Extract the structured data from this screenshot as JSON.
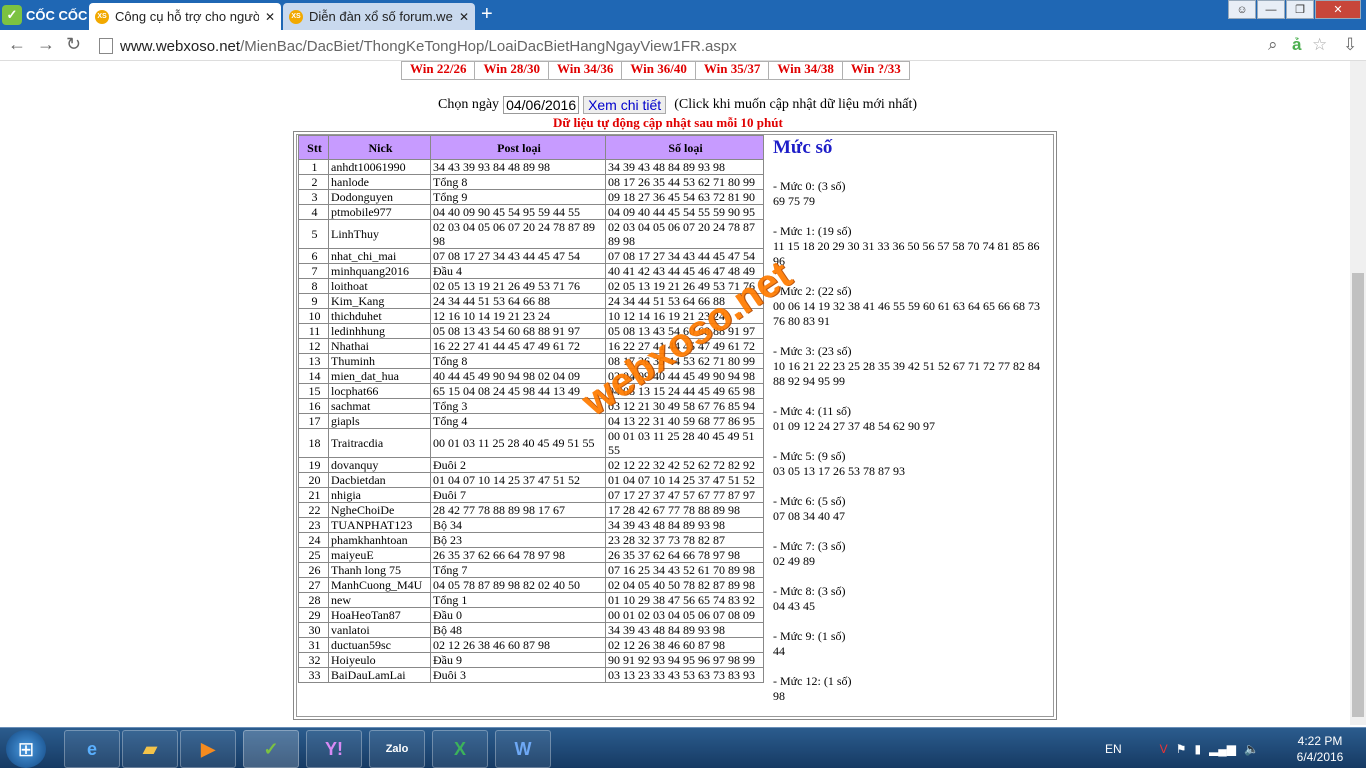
{
  "browser": {
    "brand": "CỐC CỐC",
    "tabs": [
      {
        "title": "Công cụ hỗ trợ cho người",
        "favicon": "XS"
      },
      {
        "title": "Diễn đàn xổ số forum.web",
        "favicon": "XS"
      }
    ],
    "url_host": "www.webxoso.net",
    "url_path": "/MienBac/DacBiet/ThongKeTongHop/LoaiDacBietHangNgayView1FR.aspx"
  },
  "wins": [
    "Win 22/26",
    "Win 28/30",
    "Win 34/36",
    "Win 36/40",
    "Win 35/37",
    "Win 34/38",
    "Win ?/33"
  ],
  "form": {
    "label": "Chọn ngày",
    "date": "04/06/2016",
    "button": "Xem chi tiết",
    "hint": "(Click khi muốn cập nhật dữ liệu mới nhất)",
    "auto_note": "Dữ liệu tự động cập nhật sau mỗi 10 phút"
  },
  "table": {
    "headers": [
      "Stt",
      "Nick",
      "Post loại",
      "Số loại"
    ],
    "rows": [
      [
        "1",
        "anhdt10061990",
        "34 43 39 93 84 48 89 98",
        "34 39 43 48 84 89 93 98"
      ],
      [
        "2",
        "hanlode",
        "Tổng 8",
        "08 17 26 35 44 53 62 71 80 99"
      ],
      [
        "3",
        "Dodonguyen",
        "Tổng 9",
        "09 18 27 36 45 54 63 72 81 90"
      ],
      [
        "4",
        "ptmobile977",
        "04 40 09 90 45 54 95 59 44 55",
        "04 09 40 44 45 54 55 59 90 95"
      ],
      [
        "5",
        "LinhThuy",
        "02 03 04 05 06 07 20 24 78 87 89 98",
        "02 03 04 05 06 07 20 24 78 87 89 98"
      ],
      [
        "6",
        "nhat_chi_mai",
        "07 08 17 27 34 43 44 45 47 54",
        "07 08 17 27 34 43 44 45 47 54"
      ],
      [
        "7",
        "minhquang2016",
        "Đầu 4",
        "40 41 42 43 44 45 46 47 48 49"
      ],
      [
        "8",
        "loithoat",
        "02 05 13 19 21 26 49 53 71 76",
        "02 05 13 19 21 26 49 53 71 76"
      ],
      [
        "9",
        "Kim_Kang",
        "24 34 44 51 53 64 66 88",
        "24 34 44 51 53 64 66 88"
      ],
      [
        "10",
        "thichduhet",
        "12 16 10 14 19 21 23 24",
        "10 12 14 16 19 21 23 24"
      ],
      [
        "11",
        "ledinhhung",
        "05 08 13 43 54 60 68 88 91 97",
        "05 08 13 43 54 60 68 88 91 97"
      ],
      [
        "12",
        "Nhathai",
        "16 22 27 41 44 45 47 49 61 72",
        "16 22 27 41 44 45 47 49 61 72"
      ],
      [
        "13",
        "Thuminh",
        "Tổng 8",
        "08 17 26 35 44 53 62 71 80 99"
      ],
      [
        "14",
        "mien_dat_hua",
        "40 44 45 49 90 94 98 02 04 09",
        "02 04 09 40 44 45 49 90 94 98"
      ],
      [
        "15",
        "locphat66",
        "65 15 04 08 24 45 98 44 13 49",
        "04 08 13 15 24 44 45 49 65 98"
      ],
      [
        "16",
        "sachmat",
        "Tổng 3",
        "03 12 21 30 49 58 67 76 85 94"
      ],
      [
        "17",
        "giapls",
        "Tổng 4",
        "04 13 22 31 40 59 68 77 86 95"
      ],
      [
        "18",
        "Traitracdia",
        "00 01 03 11 25 28 40 45 49 51 55",
        "00 01 03 11 25 28 40 45 49 51 55"
      ],
      [
        "19",
        "dovanquy",
        "Đuôi 2",
        "02 12 22 32 42 52 62 72 82 92"
      ],
      [
        "20",
        "Dacbietdan",
        "01 04 07 10 14 25 37 47 51 52",
        "01 04 07 10 14 25 37 47 51 52"
      ],
      [
        "21",
        "nhigia",
        "Đuôi 7",
        "07 17 27 37 47 57 67 77 87 97"
      ],
      [
        "22",
        "NgheChoiDe",
        "28 42 77 78 88 89 98 17 67",
        "17 28 42 67 77 78 88 89 98"
      ],
      [
        "23",
        "TUANPHAT123",
        "Bộ 34",
        "34 39 43 48 84 89 93 98"
      ],
      [
        "24",
        "phamkhanhtoan",
        "Bộ 23",
        "23 28 32 37 73 78 82 87"
      ],
      [
        "25",
        "maiyeuE",
        "26 35 37 62 66 64 78 97 98",
        "26 35 37 62 64 66 78 97 98"
      ],
      [
        "26",
        "Thanh long 75",
        "Tổng 7",
        "07 16 25 34 43 52 61 70 89 98"
      ],
      [
        "27",
        "ManhCuong_M4U",
        "04 05 78 87 89 98 82 02 40 50",
        "02 04 05 40 50 78 82 87 89 98"
      ],
      [
        "28",
        "new",
        "Tổng 1",
        "01 10 29 38 47 56 65 74 83 92"
      ],
      [
        "29",
        "HoaHeoTan87",
        "Đầu 0",
        "00 01 02 03 04 05 06 07 08 09"
      ],
      [
        "30",
        "vanlatoi",
        "Bộ 48",
        "34 39 43 48 84 89 93 98"
      ],
      [
        "31",
        "ductuan59sc",
        "02 12 26 38 46 60 87 98",
        "02 12 26 38 46 60 87 98"
      ],
      [
        "32",
        "Hoiyeulo",
        "Đầu 9",
        "90 91 92 93 94 95 96 97 98 99"
      ],
      [
        "33",
        "BaiDauLamLai",
        "Đuôi 3",
        "03 13 23 33 43 53 63 73 83 93"
      ]
    ]
  },
  "muc_so": {
    "title": "Mức số",
    "groups": [
      {
        "label": "- Mức 0: (3 số)",
        "nums": "69 75 79"
      },
      {
        "label": "- Mức 1: (19 số)",
        "nums": "11 15 18 20 29 30 31 33 36 50 56 57 58 70 74 81 85 86 96"
      },
      {
        "label": "- Mức 2: (22 số)",
        "nums": "00 06 14 19 32 38 41 46 55 59 60 61 63 64 65 66 68 73 76 80 83 91"
      },
      {
        "label": "- Mức 3: (23 số)",
        "nums": "10 16 21 22 23 25 28 35 39 42 51 52 67 71 72 77 82 84 88 92 94 95 99"
      },
      {
        "label": "- Mức 4: (11 số)",
        "nums": "01 09 12 24 27 37 48 54 62 90 97"
      },
      {
        "label": "- Mức 5: (9 số)",
        "nums": "03 05 13 17 26 53 78 87 93"
      },
      {
        "label": "- Mức 6: (5 số)",
        "nums": "07 08 34 40 47"
      },
      {
        "label": "- Mức 7: (3 số)",
        "nums": "02 49 89"
      },
      {
        "label": "- Mức 8: (3 số)",
        "nums": "04 43 45"
      },
      {
        "label": "- Mức 9: (1 số)",
        "nums": "44"
      },
      {
        "label": "- Mức 12: (1 số)",
        "nums": "98"
      }
    ]
  },
  "watermark": "webxoso.net",
  "taskbar": {
    "lang": "EN",
    "time": "4:22 PM",
    "date": "6/4/2016"
  }
}
